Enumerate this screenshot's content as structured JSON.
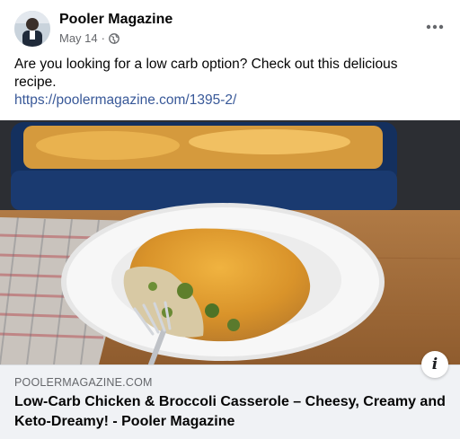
{
  "post": {
    "author": "Pooler Magazine",
    "date": "May 14",
    "separator": "·",
    "body": "Are you looking for a low carb option? Check out this delicious recipe.",
    "link": "https://poolermagazine.com/1395-2/"
  },
  "preview": {
    "domain": "POOLERMAGAZINE.COM",
    "title": "Low-Carb Chicken & Broccoli Casserole – Cheesy, Creamy and Keto-Dreamy! - Pooler Magazine"
  },
  "icons": {
    "more": "more-options-icon",
    "privacy": "globe-icon",
    "info": "info-icon"
  },
  "info_glyph": "i",
  "colors": {
    "link": "#385898",
    "meta": "#65676b",
    "preview_bg": "#f0f2f5"
  }
}
